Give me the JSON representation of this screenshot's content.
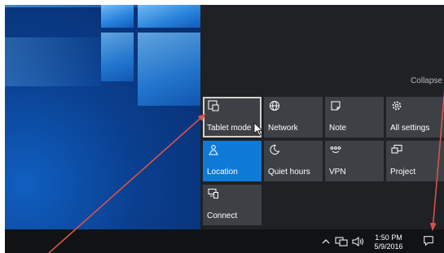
{
  "action_center": {
    "collapse_label": "Collapse",
    "tiles": [
      {
        "label": "Tablet mode",
        "icon": "tablet-mode-icon",
        "state": "focused"
      },
      {
        "label": "Network",
        "icon": "globe-icon",
        "state": "off"
      },
      {
        "label": "Note",
        "icon": "note-icon",
        "state": "off"
      },
      {
        "label": "All settings",
        "icon": "gear-icon",
        "state": "off"
      },
      {
        "label": "Location",
        "icon": "location-icon",
        "state": "on"
      },
      {
        "label": "Quiet hours",
        "icon": "moon-icon",
        "state": "off"
      },
      {
        "label": "VPN",
        "icon": "vpn-icon",
        "state": "off"
      },
      {
        "label": "Project",
        "icon": "project-icon",
        "state": "off"
      },
      {
        "label": "Connect",
        "icon": "connect-icon",
        "state": "off"
      }
    ]
  },
  "taskbar": {
    "time": "1:50 PM",
    "date": "5/9/2016",
    "tray_icons": [
      "chevron-up-icon",
      "network-icon",
      "volume-icon",
      "action-center-icon"
    ]
  },
  "colors": {
    "accent": "#0f79d6",
    "tile": "#3d4145",
    "panel": "#1f2124",
    "taskbar": "#101214",
    "annotation_arrow": "#d9534a"
  }
}
